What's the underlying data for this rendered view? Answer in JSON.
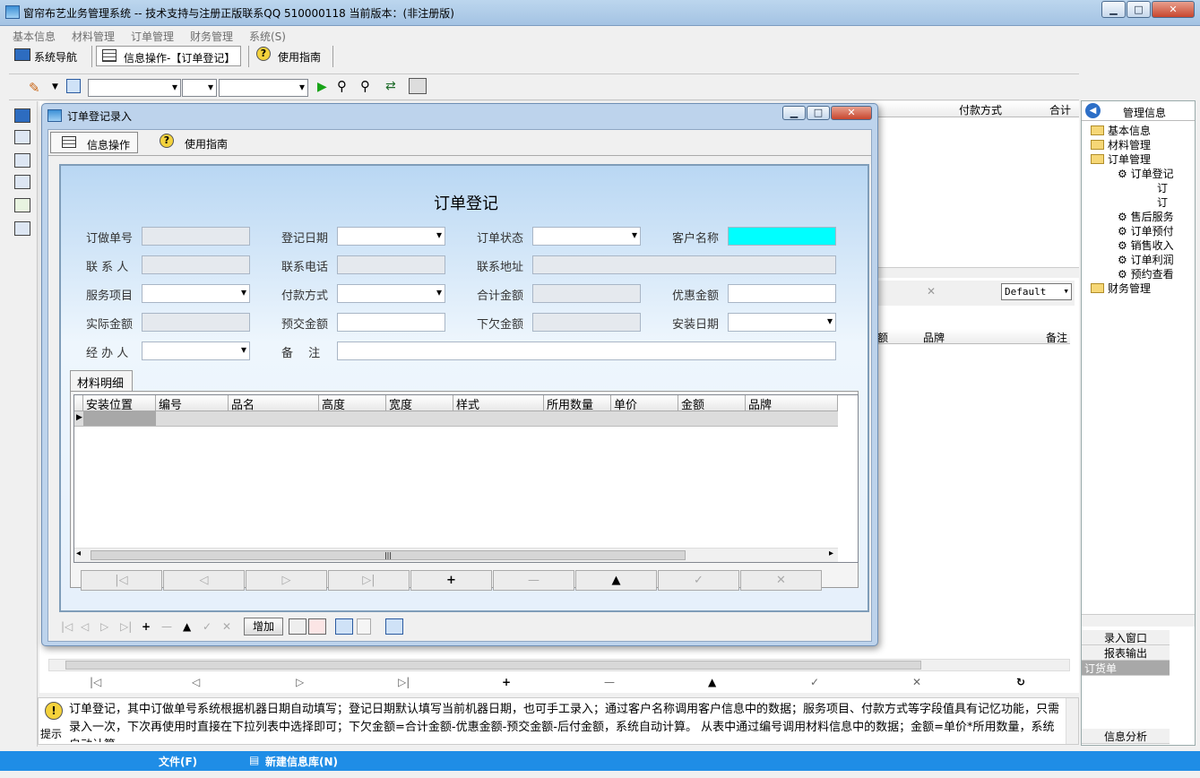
{
  "window": {
    "title": "窗帘布艺业务管理系统 -- 技术支持与注册正版联系QQ 510000118     当前版本：(非注册版)",
    "min": "▁",
    "max": "□",
    "close": "✕"
  },
  "menu": [
    "基本信息",
    "材料管理",
    "订单管理",
    "财务管理",
    "系统(S)"
  ],
  "toolbar": {
    "nav": "系统导航",
    "info": "信息操作-【订单登记】",
    "guide": "使用指南"
  },
  "bg_headers": {
    "pay": "付款方式",
    "total": "合计",
    "amount": "额",
    "brand": "品牌",
    "note": "备注",
    "default": "Default"
  },
  "right_panel": {
    "header": "管理信息",
    "tree": [
      "基本信息",
      "材料管理",
      "订单管理",
      "订单登记",
      "订",
      "订",
      "售后服务",
      "订单预付",
      "销售收入",
      "订单利润",
      "预约查看",
      "财务管理"
    ],
    "buttons": [
      "录入窗口",
      "报表输出",
      "订货单",
      "信息分析"
    ]
  },
  "hint": {
    "label": "提示",
    "text": "订单登记，其中订做单号系统根据机器日期自动填写；登记日期默认填写当前机器日期，也可手工录入；通过客户名称调用客户信息中的数据；服务项目、付款方式等字段值具有记忆功能，只需录入一次，下次再使用时直接在下拉列表中选择即可；下欠金额=合计金额-优惠金额-预交金额-后付金额，系统自动计算。 从表中通过编号调用材料信息中的数据；金额=单价*所用数量，系统自动计算。"
  },
  "statusbar": {
    "file": "文件(F)",
    "newdb": "新建信息库(N)"
  },
  "dialog": {
    "title": "订单登记录入",
    "tab_info": "信息操作",
    "tab_guide": "使用指南",
    "form_title": "订单登记",
    "labels": {
      "order_no": "订做单号",
      "reg_date": "登记日期",
      "status": "订单状态",
      "customer": "客户名称",
      "contact": "联 系 人",
      "phone": "联系电话",
      "address": "联系地址",
      "service": "服务项目",
      "pay_method": "付款方式",
      "total": "合计金额",
      "discount": "优惠金额",
      "actual": "实际金额",
      "prepay": "预交金额",
      "owed": "下欠金额",
      "install_date": "安装日期",
      "handler": "经 办 人",
      "remark": "备　 注"
    },
    "detail_tab": "材料明细",
    "grid_headers": [
      "安装位置",
      "编号",
      "品名",
      "高度",
      "宽度",
      "样式",
      "所用数量",
      "单价",
      "金额",
      "品牌"
    ],
    "scroll_mark": "|||",
    "nav": [
      "|◁",
      "◁",
      "▷",
      "▷|",
      "+",
      "—",
      "▲",
      "✓",
      "✕"
    ],
    "bottom": {
      "add": "增加"
    }
  }
}
